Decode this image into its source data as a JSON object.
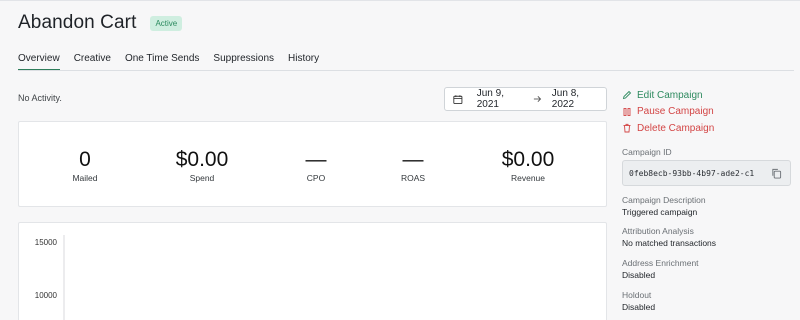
{
  "campaign": {
    "title": "Abandon Cart",
    "status": "Active"
  },
  "tabs": [
    {
      "label": "Overview",
      "active": true
    },
    {
      "label": "Creative"
    },
    {
      "label": "One Time Sends"
    },
    {
      "label": "Suppressions"
    },
    {
      "label": "History"
    }
  ],
  "activity_note": "No Activity.",
  "date_range": {
    "start": "Jun 9, 2021",
    "end": "Jun 8, 2022",
    "separator_icon": "arrow-right-icon"
  },
  "stats": [
    {
      "value": "0",
      "label": "Mailed"
    },
    {
      "value": "$0.00",
      "label": "Spend"
    },
    {
      "value": "—",
      "label": "CPO"
    },
    {
      "value": "—",
      "label": "ROAS"
    },
    {
      "value": "$0.00",
      "label": "Revenue"
    }
  ],
  "chart_data": {
    "type": "line",
    "y_ticks": [
      "15000",
      "10000"
    ],
    "series": [],
    "grid": false
  },
  "actions": {
    "edit": "Edit Campaign",
    "pause": "Pause Campaign",
    "delete": "Delete Campaign"
  },
  "details": {
    "campaign_id_label": "Campaign ID",
    "campaign_id_value": "0feb8ecb-93bb-4b97-ade2-c1",
    "description_label": "Campaign Description",
    "description_value": "Triggered campaign",
    "attribution_label": "Attribution Analysis",
    "attribution_value": "No matched transactions",
    "enrichment_label": "Address Enrichment",
    "enrichment_value": "Disabled",
    "holdout_label": "Holdout",
    "holdout_value": "Disabled"
  },
  "colors": {
    "accent_green": "#2e8a5f",
    "danger_red": "#d34545",
    "badge_bg": "#cfeee0"
  }
}
